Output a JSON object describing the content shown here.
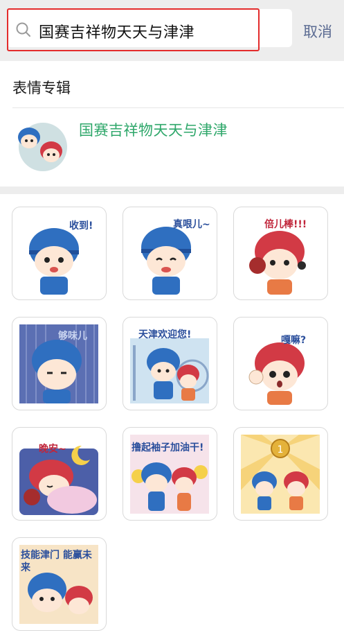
{
  "search": {
    "query": "国赛吉祥物天天与津津",
    "cancel_label": "取消"
  },
  "album_section": {
    "title": "表情专辑",
    "album_name": "国赛吉祥物天天与津津"
  },
  "stickers": [
    {
      "caption": "收到!",
      "mascot": "blue"
    },
    {
      "caption": "真哏儿~",
      "mascot": "blue"
    },
    {
      "caption": "倍儿棒!!!",
      "mascot": "red"
    },
    {
      "caption": "够味儿",
      "mascot": "blue"
    },
    {
      "caption": "天津欢迎您!",
      "mascot": "both"
    },
    {
      "caption": "嘎嘛?",
      "mascot": "red"
    },
    {
      "caption": "晚安~",
      "mascot": "red"
    },
    {
      "caption": "撸起袖子加油干!",
      "mascot": "both"
    },
    {
      "caption": "",
      "mascot": "both"
    },
    {
      "caption": "技能津门 能赢未来",
      "mascot": "both"
    }
  ],
  "colors": {
    "album_name": "#2ea76a",
    "cancel": "#5b6b92",
    "highlight": "#e32b2b",
    "mascot_blue": "#2f6fc0",
    "mascot_red": "#d23a45"
  }
}
